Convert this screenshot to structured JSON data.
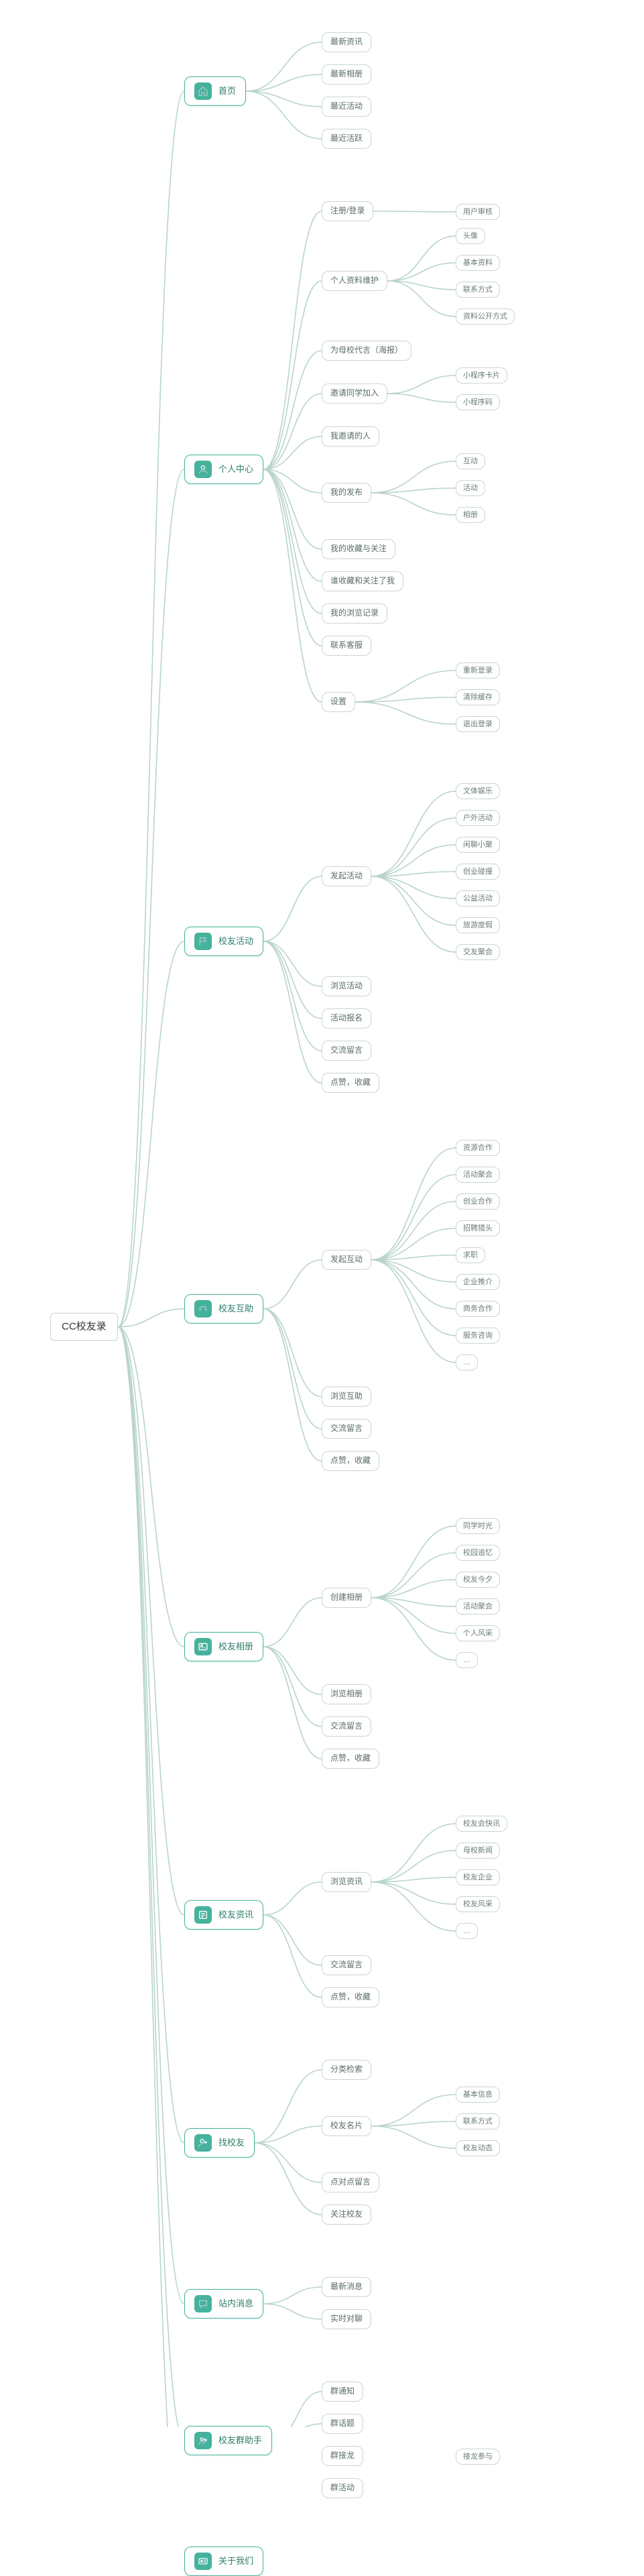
{
  "root": "CC校友录",
  "sections": [
    {
      "id": "home",
      "label": "首页",
      "icon": "home",
      "children": [
        {
          "label": "最新资讯"
        },
        {
          "label": "最新相册"
        },
        {
          "label": "最近活动"
        },
        {
          "label": "最近活跃"
        }
      ]
    },
    {
      "id": "me",
      "label": "个人中心",
      "icon": "user",
      "children": [
        {
          "label": "注册/登录",
          "children": [
            {
              "label": "用户审核"
            }
          ]
        },
        {
          "label": "个人资料维护",
          "children": [
            {
              "label": "头像"
            },
            {
              "label": "基本资料"
            },
            {
              "label": "联系方式"
            },
            {
              "label": "资料公开方式"
            }
          ]
        },
        {
          "label": "为母校代言（海报）"
        },
        {
          "label": "邀请同学加入",
          "children": [
            {
              "label": "小程序卡片"
            },
            {
              "label": "小程序码"
            }
          ]
        },
        {
          "label": "我邀请的人"
        },
        {
          "label": "我的发布",
          "children": [
            {
              "label": "互动"
            },
            {
              "label": "活动"
            },
            {
              "label": "相册"
            }
          ]
        },
        {
          "label": "我的收藏与关注"
        },
        {
          "label": "谁收藏和关注了我"
        },
        {
          "label": "我的浏览记录"
        },
        {
          "label": "联系客服"
        },
        {
          "label": "设置",
          "children": [
            {
              "label": "重新登录"
            },
            {
              "label": "清除缓存"
            },
            {
              "label": "退出登录"
            }
          ]
        }
      ]
    },
    {
      "id": "activity",
      "label": "校友活动",
      "icon": "flag",
      "children": [
        {
          "label": "发起活动",
          "children": [
            {
              "label": "文体娱乐"
            },
            {
              "label": "户外活动"
            },
            {
              "label": "闲聊小聚"
            },
            {
              "label": "创业碰撞"
            },
            {
              "label": "公益活动"
            },
            {
              "label": "旅游度假"
            },
            {
              "label": "交友聚会"
            }
          ]
        },
        {
          "label": "浏览活动"
        },
        {
          "label": "活动报名"
        },
        {
          "label": "交流留言"
        },
        {
          "label": "点赞，收藏"
        }
      ]
    },
    {
      "id": "help",
      "label": "校友互助",
      "icon": "hands",
      "children": [
        {
          "label": "发起互动",
          "children": [
            {
              "label": "资源合作"
            },
            {
              "label": "活动聚会"
            },
            {
              "label": "创业合作"
            },
            {
              "label": "招聘猎头"
            },
            {
              "label": "求职"
            },
            {
              "label": "企业推介"
            },
            {
              "label": "商务合作"
            },
            {
              "label": "服务咨询"
            },
            {
              "label": "…"
            }
          ]
        },
        {
          "label": "浏览互助"
        },
        {
          "label": "交流留言"
        },
        {
          "label": "点赞，收藏"
        }
      ]
    },
    {
      "id": "album",
      "label": "校友相册",
      "icon": "image",
      "children": [
        {
          "label": "创建相册",
          "children": [
            {
              "label": "同学时光"
            },
            {
              "label": "校园追忆"
            },
            {
              "label": "校友今夕"
            },
            {
              "label": "活动聚会"
            },
            {
              "label": "个人风采"
            },
            {
              "label": "…"
            }
          ]
        },
        {
          "label": "浏览相册"
        },
        {
          "label": "交流留言"
        },
        {
          "label": "点赞，收藏"
        }
      ]
    },
    {
      "id": "news",
      "label": "校友资讯",
      "icon": "news",
      "children": [
        {
          "label": "浏览资讯",
          "children": [
            {
              "label": "校友会快讯"
            },
            {
              "label": "母校新闻"
            },
            {
              "label": "校友企业"
            },
            {
              "label": "校友风采"
            },
            {
              "label": "…"
            }
          ]
        },
        {
          "label": "交流留言"
        },
        {
          "label": "点赞，收藏"
        }
      ]
    },
    {
      "id": "find",
      "label": "找校友",
      "icon": "addUser",
      "children": [
        {
          "label": "分类检索"
        },
        {
          "label": "校友名片",
          "children": [
            {
              "label": "基本信息"
            },
            {
              "label": "联系方式"
            },
            {
              "label": "校友动态"
            }
          ]
        },
        {
          "label": "点对点留言"
        },
        {
          "label": "关注校友"
        }
      ]
    },
    {
      "id": "msg",
      "label": "站内消息",
      "icon": "chat",
      "children": [
        {
          "label": "最新消息"
        },
        {
          "label": "实时对聊"
        }
      ]
    },
    {
      "id": "group",
      "label": "校友群助手",
      "icon": "group",
      "children": [
        {
          "label": "群通知"
        },
        {
          "label": "群话题"
        },
        {
          "label": "群接龙",
          "children": [
            {
              "label": "接龙参与"
            }
          ]
        },
        {
          "label": "群活动"
        }
      ]
    },
    {
      "id": "about",
      "label": "关于我们",
      "icon": "card",
      "children": []
    }
  ]
}
